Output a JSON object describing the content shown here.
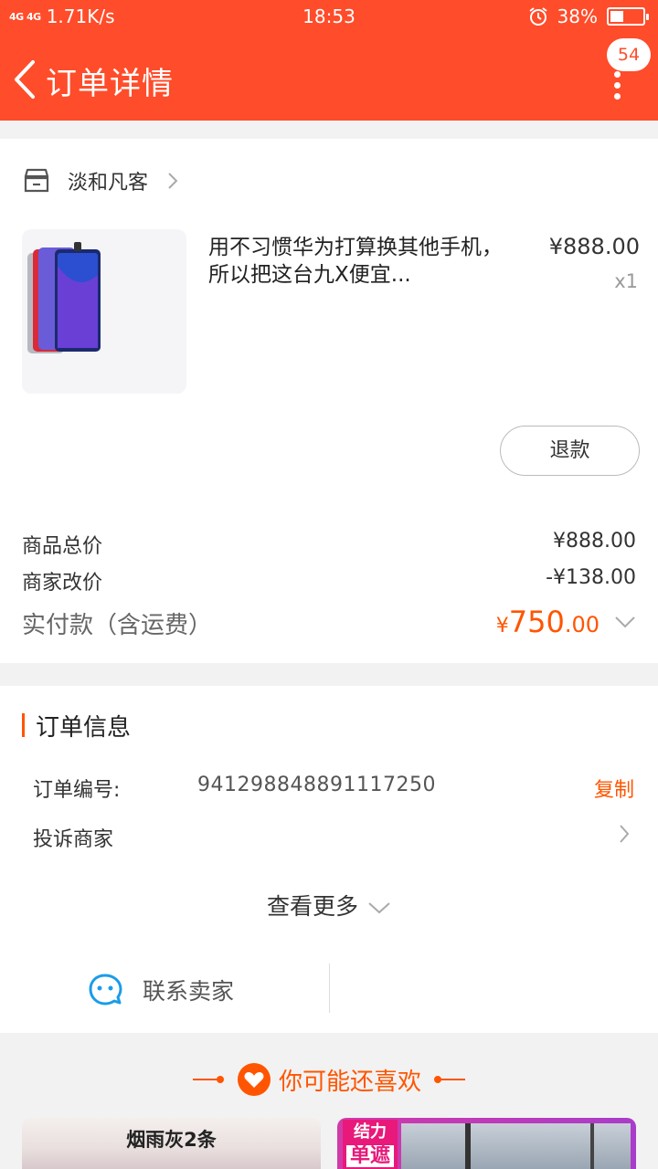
{
  "status_bar": {
    "signal": "4G 4G",
    "speed": "1.71K/s",
    "time": "18:53",
    "battery": "38%",
    "battery_level": 0.38
  },
  "header": {
    "title": "订单详情",
    "badge": "54"
  },
  "shop": {
    "name": "淡和凡客"
  },
  "product": {
    "title": "用不习惯华为打算换其他手机，所以把这台九X便宜...",
    "price": "¥888.00",
    "qty": "x1"
  },
  "actions": {
    "refund": "退款"
  },
  "price_summary": {
    "goods_total_label": "商品总价",
    "goods_total": "¥888.00",
    "seller_adjust_label": "商家改价",
    "seller_adjust": "-¥138.00",
    "paid_label": "实付款（含运费）",
    "paid_currency": "¥",
    "paid_int": "750",
    "paid_dec": ".00"
  },
  "order_info": {
    "section_title": "订单信息",
    "order_no_label": "订单编号:",
    "order_no": "941298848891117250",
    "copy": "复制",
    "complain": "投诉商家",
    "see_more": "查看更多",
    "contact": "联系卖家"
  },
  "recommend": {
    "title": "你可能还喜欢",
    "card1_caption": "烟雨灰2条",
    "card2_tag_top": "结力",
    "card2_tag_big": "单遮"
  },
  "colors": {
    "brand": "#ff4c2a",
    "accent": "#ff5500"
  }
}
